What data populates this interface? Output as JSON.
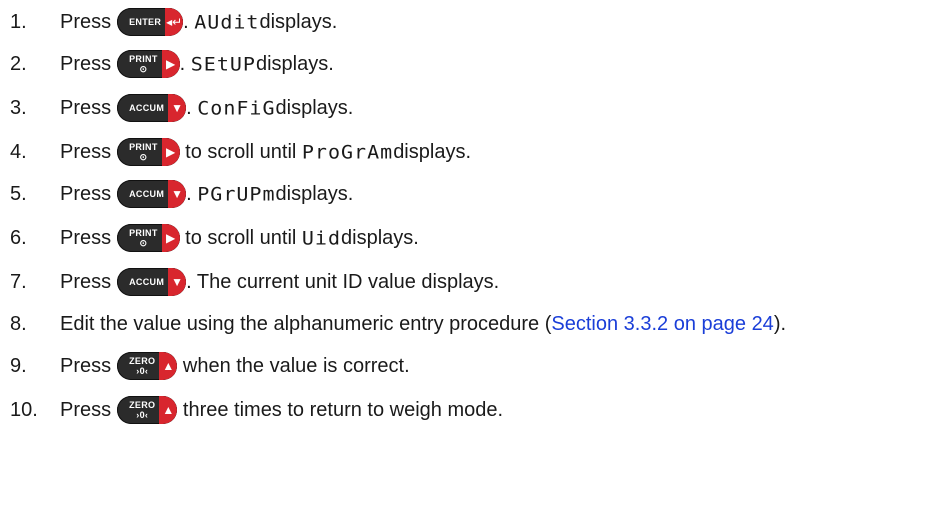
{
  "step_label": "Press",
  "keys": {
    "enter": {
      "label": "ENTER",
      "arrow": "◂↵"
    },
    "print": {
      "label": "PRINT",
      "sub": "⊙",
      "arrow": "▶"
    },
    "accum": {
      "label": "ACCUM",
      "arrow": "▼"
    },
    "zero": {
      "label": "ZERO",
      "sub": "›0‹",
      "arrow": "▲"
    }
  },
  "steps": [
    {
      "num": "1.",
      "key": "enter",
      "pre": "",
      "display": "AUdit",
      "post": " displays."
    },
    {
      "num": "2.",
      "key": "print",
      "pre": "",
      "display": "SEtUP",
      "post": " displays."
    },
    {
      "num": "3.",
      "key": "accum",
      "pre": "",
      "display": "ConFiG",
      "post": " displays."
    },
    {
      "num": "4.",
      "key": "print",
      "pre": " to scroll until ",
      "display": "ProGrAm",
      "post": " displays."
    },
    {
      "num": "5.",
      "key": "accum",
      "pre": "",
      "display": "PGrUPm",
      "post": " displays."
    },
    {
      "num": "6.",
      "key": "print",
      "pre": " to scroll until ",
      "display": "Uid",
      "post": " displays."
    },
    {
      "num": "7.",
      "key": "accum",
      "text": ". The current unit ID value displays."
    },
    {
      "num": "8.",
      "text_a": "Edit the value using the alphanumeric entry procedure (",
      "link": "Section 3.3.2 on page 24",
      "text_b": ")."
    },
    {
      "num": "9.",
      "key": "zero",
      "text": " when the value is correct."
    },
    {
      "num": "10.",
      "key": "zero",
      "text": " three times to return to weigh mode."
    }
  ]
}
